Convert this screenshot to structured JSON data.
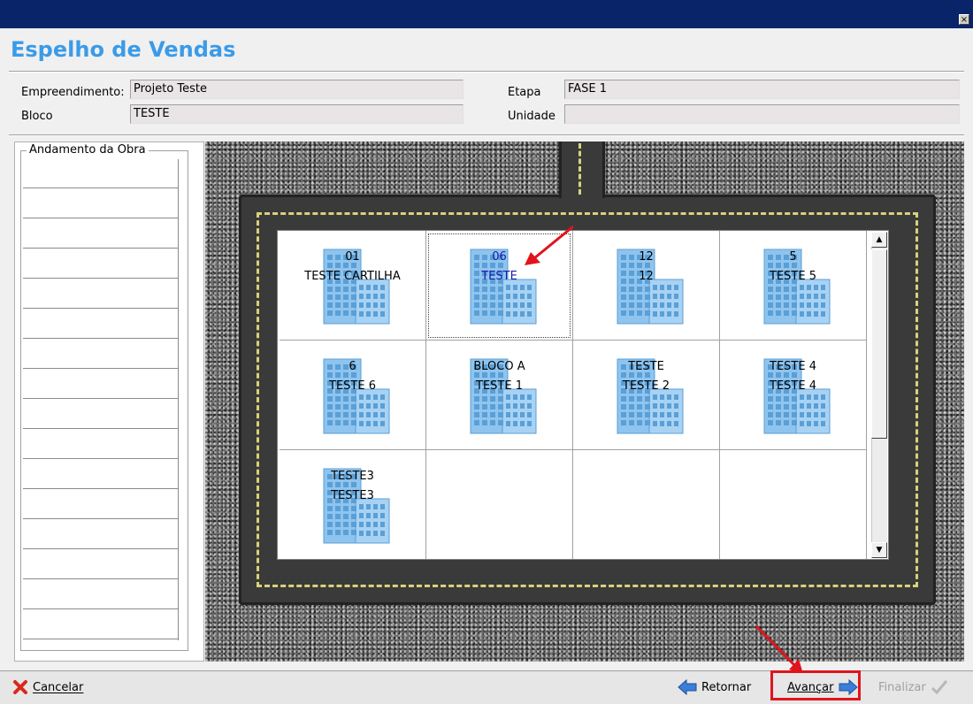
{
  "window": {
    "close_glyph": "×"
  },
  "page": {
    "title": "Espelho de Vendas"
  },
  "form": {
    "empreendimento_label": "Empreendimento:",
    "empreendimento_value": "Projeto Teste",
    "bloco_label": "Bloco",
    "bloco_value": "TESTE",
    "etapa_label": "Etapa",
    "etapa_value": "FASE 1",
    "unidade_label": "Unidade",
    "unidade_value": ""
  },
  "progress": {
    "legend": "Andamento da Obra"
  },
  "blocks": [
    {
      "line1": "01",
      "line2": "TESTE CARTILHA",
      "selected": false
    },
    {
      "line1": "06",
      "line2": "TESTE",
      "selected": true
    },
    {
      "line1": "12",
      "line2": "12",
      "selected": false
    },
    {
      "line1": "5",
      "line2": "TESTE 5",
      "selected": false
    },
    {
      "line1": "6",
      "line2": "TESTE 6",
      "selected": false
    },
    {
      "line1": "BLOCO A",
      "line2": "TESTE 1",
      "selected": false
    },
    {
      "line1": "TESTE",
      "line2": "TESTE 2",
      "selected": false
    },
    {
      "line1": "TESTE 4",
      "line2": "TESTE 4",
      "selected": false
    },
    {
      "line1": "TESTE3",
      "line2": "TESTE3",
      "selected": false
    }
  ],
  "footer": {
    "cancel_label": "Cancelar",
    "back_label": "Retornar",
    "next_label": "Avançar",
    "finish_label": "Finalizar"
  },
  "colors": {
    "accent": "#3a9be8",
    "titlebar": "#0a246a",
    "highlight": "#e0141c",
    "building": "#8fc4ef"
  }
}
